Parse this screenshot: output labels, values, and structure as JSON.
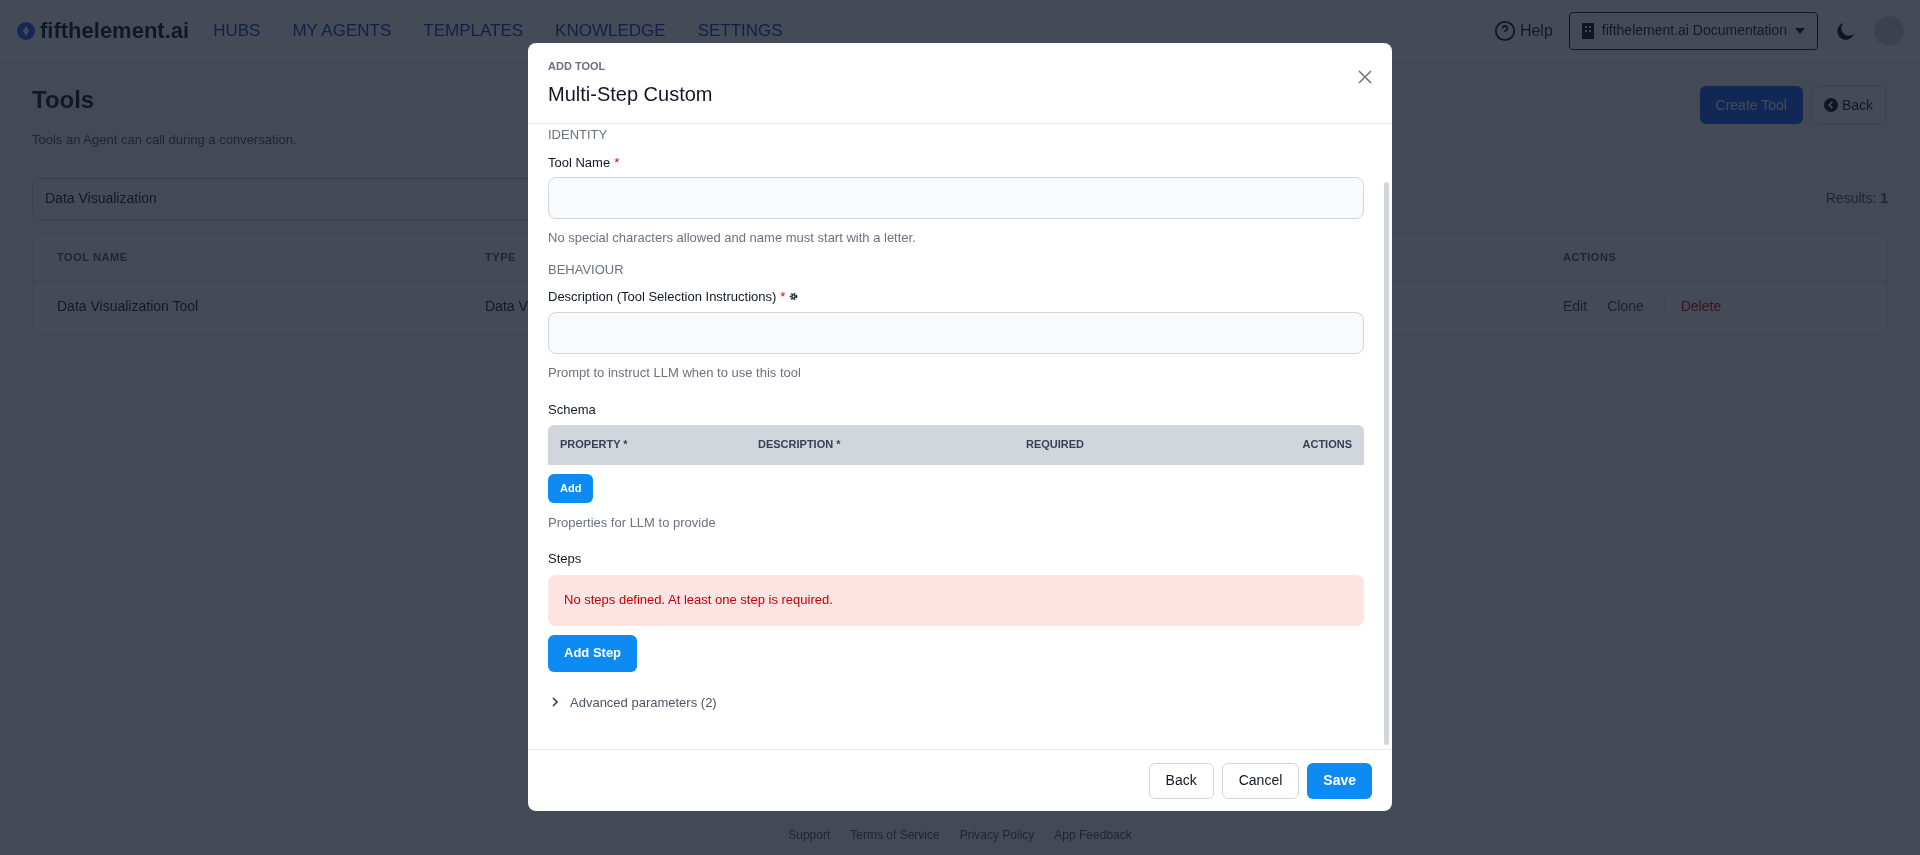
{
  "nav": {
    "brand": "fifthelement.ai",
    "items": [
      "HUBS",
      "MY AGENTS",
      "TEMPLATES",
      "KNOWLEDGE",
      "SETTINGS"
    ],
    "help": "Help",
    "workspace": "fifthelement.ai Documentation"
  },
  "page": {
    "title": "Tools",
    "subtitle": "Tools an Agent can call during a conversation.",
    "create_button": "Create Tool",
    "back_button": "Back",
    "search": {
      "value": "Data Visualization"
    },
    "results_label": "Results:",
    "results_count": "1"
  },
  "table": {
    "columns": [
      "TOOL NAME",
      "TYPE",
      "ACTIONS"
    ],
    "rows": [
      {
        "name": "Data Visualization Tool",
        "type": "Data V",
        "actions": [
          {
            "label": "Edit",
            "kind": "normal"
          },
          {
            "label": "Clone",
            "kind": "normal"
          },
          {
            "label": "Delete",
            "kind": "danger"
          }
        ]
      }
    ]
  },
  "footer": [
    "Support",
    "Terms of Service",
    "Privacy Policy",
    "App Feedback"
  ],
  "dialog": {
    "eyebrow": "ADD TOOL",
    "title": "Multi-Step Custom",
    "sections": [
      {
        "heading": "IDENTITY",
        "fields": [
          {
            "label": "Tool Name",
            "required_mark": "*",
            "settings_icon": false,
            "hint": "No special characters allowed and name must start with a letter."
          }
        ]
      },
      {
        "heading": "BEHAVIOUR",
        "fields": [
          {
            "label": "Description (Tool Selection Instructions)",
            "required_mark": "*",
            "settings_icon": true,
            "hint": "Prompt to instruct LLM when to use this tool"
          }
        ]
      }
    ],
    "schema": {
      "label": "Schema",
      "columns": [
        "PROPERTY *",
        "DESCRIPTION *",
        "REQUIRED",
        "ACTIONS"
      ],
      "add_button": "Add",
      "hint": "Properties for LLM to provide"
    },
    "steps": {
      "label": "Steps",
      "error": "No steps defined. At least one step is required.",
      "add_button": "Add Step"
    },
    "advanced": {
      "label": "Advanced parameters",
      "count": "(2)",
      "expanded": false
    },
    "buttons": [
      {
        "label": "Back",
        "kind": "secondary"
      },
      {
        "label": "Cancel",
        "kind": "secondary"
      },
      {
        "label": "Save",
        "kind": "primary"
      }
    ]
  }
}
